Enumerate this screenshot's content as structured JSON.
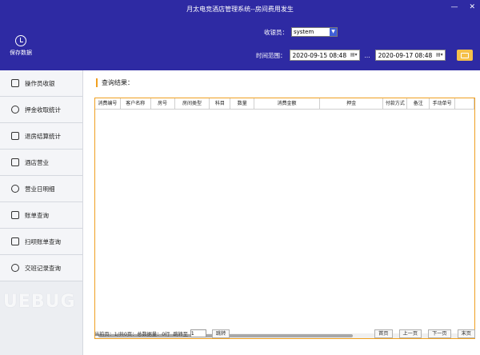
{
  "window": {
    "title": "月太电竞酒店管理系统--房间费用发生",
    "minimize": "—",
    "close": "✕"
  },
  "toolbar": {
    "save_label": "保存数据"
  },
  "filters": {
    "cashier_label": "收银员：",
    "cashier_value": "system",
    "time_range_label": "时间范围：",
    "start_date": "2020-09-15 08:48",
    "range_sep": "...",
    "end_date": "2020-09-17 08:48"
  },
  "sidebar": {
    "items": [
      {
        "label": "操作员收银",
        "icon": "cashier-icon"
      },
      {
        "label": "押金收取统计",
        "icon": "deposit-icon"
      },
      {
        "label": "退房结算统计",
        "icon": "checkout-icon"
      },
      {
        "label": "酒店营业",
        "icon": "hotel-icon"
      },
      {
        "label": "营业日明细",
        "icon": "clock-icon"
      },
      {
        "label": "账单查询",
        "icon": "bill-icon"
      },
      {
        "label": "扫呗账单查询",
        "icon": "scan-icon"
      },
      {
        "label": "交班记录查询",
        "icon": "shift-icon"
      }
    ]
  },
  "main": {
    "results_label": "查询结果：",
    "columns": [
      {
        "label": "消费编号",
        "w": 32
      },
      {
        "label": "客户名称",
        "w": 38
      },
      {
        "label": "房号",
        "w": 30
      },
      {
        "label": "房间类型",
        "w": 44
      },
      {
        "label": "科目",
        "w": 26
      },
      {
        "label": "数量",
        "w": 30
      },
      {
        "label": "消费金额",
        "w": 82
      },
      {
        "label": "押金",
        "w": 80
      },
      {
        "label": "付款方式",
        "w": 30
      },
      {
        "label": "备注",
        "w": 28
      },
      {
        "label": "手动单号",
        "w": 32
      },
      {
        "label": "",
        "w": 24
      }
    ]
  },
  "footer": {
    "page_info": "当前页：1/共0页：总数据量：0行",
    "goto_label": "跳转至",
    "goto_value": "1",
    "jump_btn": "跳转",
    "first": "首页",
    "prev": "上一页",
    "next": "下一页",
    "last": "末页"
  },
  "watermark": "UEBUG"
}
